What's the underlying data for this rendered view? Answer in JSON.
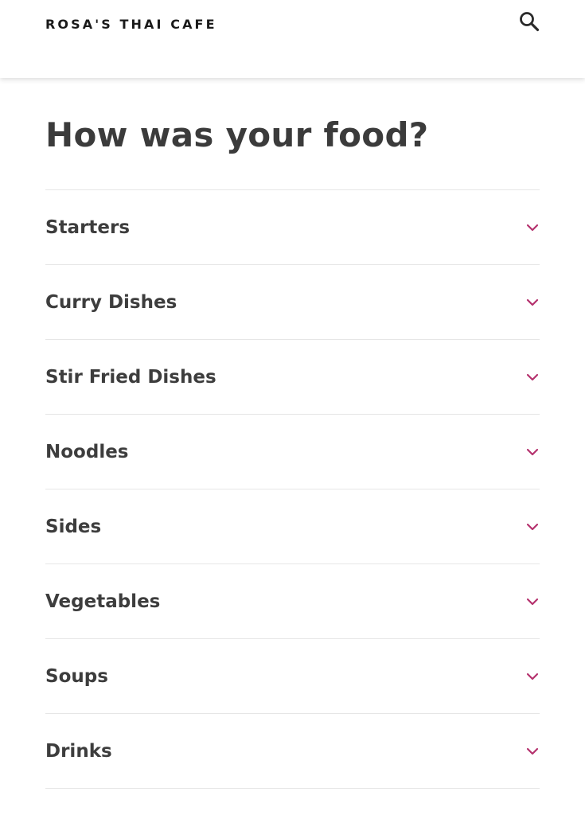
{
  "header": {
    "logo_text": "ROSA'S THAI CAFE",
    "search_icon": "search-icon"
  },
  "main": {
    "title": "How was your food?",
    "categories": [
      {
        "label": "Starters",
        "icon": "chevron-down-icon"
      },
      {
        "label": "Curry Dishes",
        "icon": "chevron-down-icon"
      },
      {
        "label": "Stir Fried Dishes",
        "icon": "chevron-down-icon"
      },
      {
        "label": "Noodles",
        "icon": "chevron-down-icon"
      },
      {
        "label": "Sides",
        "icon": "chevron-down-icon"
      },
      {
        "label": "Vegetables",
        "icon": "chevron-down-icon"
      },
      {
        "label": "Soups",
        "icon": "chevron-down-icon"
      },
      {
        "label": "Drinks",
        "icon": "chevron-down-icon"
      }
    ]
  },
  "colors": {
    "accent": "#b5326e",
    "text": "#3b3b3b",
    "divider": "#e6e6e6"
  }
}
